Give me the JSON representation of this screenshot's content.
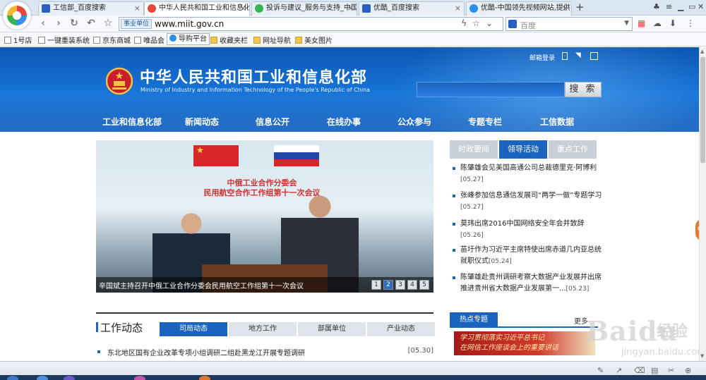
{
  "browser": {
    "tabs": [
      {
        "label": "工信部_百度搜索",
        "active": false
      },
      {
        "label": "中华人民共和国工业和信息化",
        "active": true
      },
      {
        "label": "投诉与建议_服务与支持_中国",
        "active": false
      },
      {
        "label": "优酷_百度搜索",
        "active": false
      },
      {
        "label": "优酷-中国领先视频网站,提供",
        "active": false
      }
    ],
    "new_tab": "+",
    "url_tag": "事业单位",
    "url": "www.miit.gov.cn",
    "search_placeholder": "百度",
    "bookmarks": [
      "1号店",
      "一键重装系统",
      "京东商城",
      "唯品会",
      "导购平台",
      "收藏夹栏",
      "网址导航",
      "美女图片"
    ]
  },
  "site": {
    "title": "中华人民共和国工业和信息化部",
    "subtitle": "Ministry of Industry and Information Technology of the People's Republic of China",
    "top_link": "邮箱登录",
    "search_button": "搜 索",
    "nav": [
      "工业和信息化部",
      "新闻动态",
      "信息公开",
      "在线办事",
      "公众参与",
      "专题专栏",
      "工信数据"
    ]
  },
  "banner": {
    "stage_line1": "中俄工业合作分委会",
    "stage_line2": "民用航空合作工作组第十一次会议",
    "caption": "辛国斌主持召开中俄工业合作分委会民用航空工作组第十一次会议",
    "pages": [
      "1",
      "2",
      "3",
      "4",
      "5"
    ],
    "active_page": "2"
  },
  "news": {
    "tabs": [
      "时政要闻",
      "领导活动",
      "重点工作"
    ],
    "active_tab": "领导活动",
    "items": [
      {
        "text": "陈肇雄会见美国高通公司总裁德里克·阿博利",
        "date": "[05.27]"
      },
      {
        "text": "张峰参加信息通信发展司“两学一做”专题学习",
        "date": "[05.27]"
      },
      {
        "text": "莫玮出席2016中国网络安全年会并致辞",
        "date": "[05.26]"
      },
      {
        "text": "苗圩作为习近平主席特使出席赤道几内亚总统就职仪式",
        "date": "[05.24]"
      },
      {
        "text": "陈肇雄赴贵州调研考察大数据产业发展并出席推进贵州省大数据产业发展第一...",
        "date": "[05.23]"
      }
    ]
  },
  "work": {
    "title": "工作动态",
    "tabs": [
      "司局动态",
      "地方工作",
      "部属单位",
      "产业动态"
    ],
    "active_tab": "司局动态",
    "row_text": "东北地区国有企业改革专项小组调研二组赴黑龙江开展专题调研",
    "row_date": "[05.30]"
  },
  "hot": {
    "title": "热点专题",
    "more": "更多",
    "banner_line1": "学习贯彻落实习近平总书记",
    "banner_line2": "在网信工作座谈会上的重要讲话"
  },
  "float_badge": "68",
  "watermark": {
    "brand": "Baidu",
    "suffix": "经验",
    "url": "jingyan.baidu.com"
  },
  "colors": {
    "accent": "#1a63bf",
    "header": "#1775d8"
  }
}
